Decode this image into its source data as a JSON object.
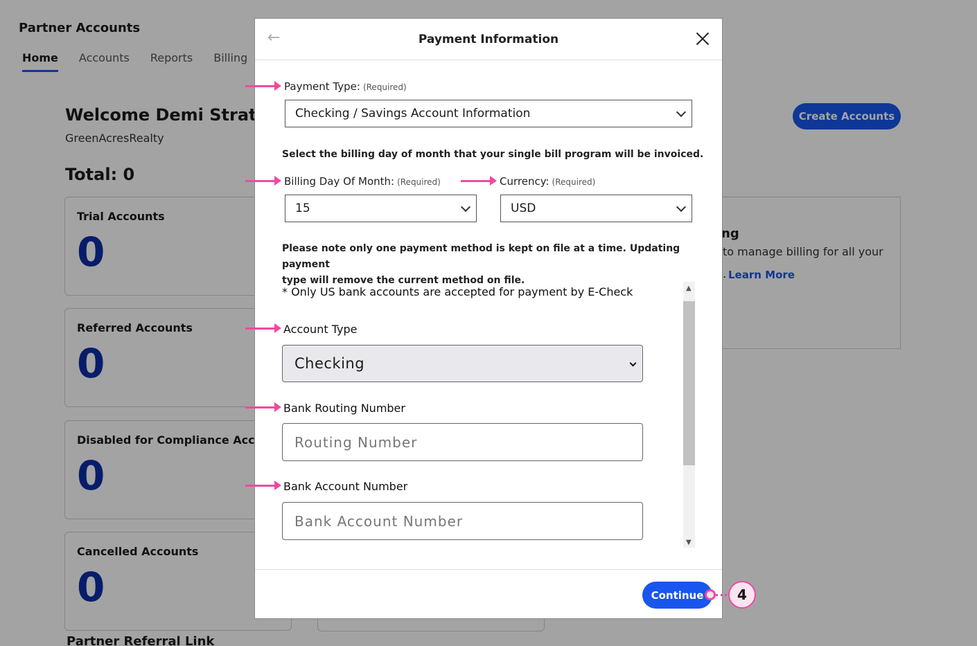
{
  "app": {
    "title": "Partner Accounts",
    "nav": [
      "Home",
      "Accounts",
      "Reports",
      "Billing"
    ],
    "welcome": "Welcome Demi Stratto",
    "company": "GreenAcresRealty",
    "total": "Total: 0",
    "create_button": "Create Accounts",
    "cards": [
      {
        "label": "Trial Accounts",
        "count": "0"
      },
      {
        "label": "Referred Accounts",
        "count": "0"
      },
      {
        "label": "Disabled for Compliance Accou",
        "count": "0"
      },
      {
        "label": "Cancelled Accounts",
        "count": "0"
      }
    ],
    "billing_card": {
      "title": "ng",
      "desc": "to manage billing for all your",
      "learn_more": "Learn More",
      "learn_prefix": "."
    },
    "referral_link": "Partner Referral Link"
  },
  "modal": {
    "back_icon": "←",
    "title": "Payment Information",
    "payment_type_label": "Payment Type:",
    "required": "(Required)",
    "payment_type_value": "Checking / Savings Account Information",
    "billing_note": "Select the billing day of month that your single bill program will be invoiced.",
    "billing_day_label": "Billing Day Of Month:",
    "billing_day_value": "15",
    "currency_label": "Currency:",
    "currency_value": "USD",
    "payment_note_line1": "Please note only one payment method is kept on file at a time. Updating payment",
    "payment_note_line2": "type will remove the current method on file.",
    "echeck_note": "* Only US bank accounts are accepted for payment by E-Check",
    "account_type_label": "Account Type",
    "account_type_value": "Checking",
    "routing_label": "Bank Routing Number",
    "routing_placeholder": "Routing Number",
    "account_number_label": "Bank Account Number",
    "account_number_placeholder": "Bank Account Number",
    "continue_button": "Continue"
  },
  "annotation": {
    "step": "4",
    "color": "#ef4a9f"
  },
  "colors": {
    "accent": "#1856ed",
    "count": "#0b2ea8"
  }
}
